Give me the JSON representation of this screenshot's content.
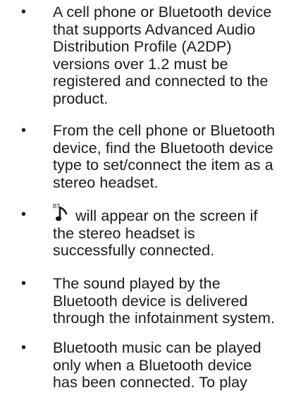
{
  "bullets": [
    {
      "marker": "•",
      "lines": [
        "A cell phone or Bluetooth device",
        "that supports Advanced Audio",
        "Distribution Profile (A2DP)",
        "versions over 1.2 must be",
        "registered and connected to the",
        "product."
      ]
    },
    {
      "marker": "•",
      "lines": [
        "From the cell phone or Bluetooth",
        "device, find the Bluetooth device",
        "type to set/connect the item as a",
        "stereo headset."
      ]
    },
    {
      "marker": "•",
      "icon": "bluetooth-music-icon",
      "icon_label": "BT",
      "lines": [
        "will appear on the screen if",
        "the stereo headset is",
        "successfully connected."
      ]
    },
    {
      "marker": "•",
      "lines": [
        "The sound played by the",
        "Bluetooth device is delivered",
        "through the infotainment system."
      ]
    },
    {
      "marker": "•",
      "lines": [
        "Bluetooth music can be played",
        "only when a Bluetooth device",
        "has been connected. To play"
      ]
    }
  ]
}
